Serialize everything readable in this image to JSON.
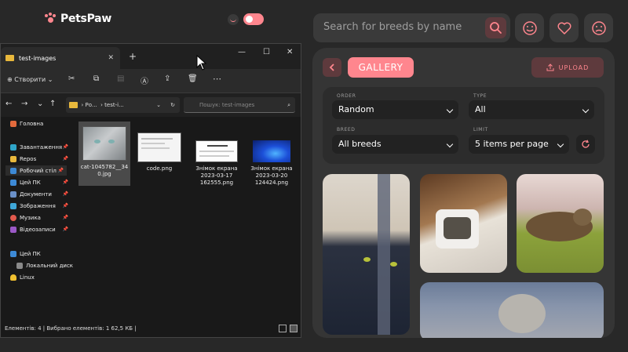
{
  "app": {
    "logo_text": "PetsPaw"
  },
  "search": {
    "placeholder": "Search for breeds by name"
  },
  "gallery": {
    "title": "GALLERY",
    "upload_label": "UPLOAD",
    "filters": {
      "order_label": "ORDER",
      "order_value": "Random",
      "type_label": "TYPE",
      "type_value": "All",
      "breed_label": "BREED",
      "breed_value": "All breeds",
      "limit_label": "LIMIT",
      "limit_value": "5 items per page"
    }
  },
  "explorer": {
    "tab_title": "test-images",
    "toolbar": {
      "create_label": "Створити"
    },
    "address": {
      "path_segments": [
        "Ро...",
        "test-i..."
      ],
      "search_placeholder": "Пошук: test-images"
    },
    "sidebar": [
      {
        "label": "Головна"
      },
      {
        "label": "Завантаження"
      },
      {
        "label": "Repos"
      },
      {
        "label": "Робочий стіл"
      },
      {
        "label": "Цей ПК"
      },
      {
        "label": "Документи"
      },
      {
        "label": "Зображення"
      },
      {
        "label": "Музика"
      },
      {
        "label": "Відеозаписи"
      },
      {
        "label": "Цей ПК"
      },
      {
        "label": "Локальний диск"
      },
      {
        "label": "Linux"
      }
    ],
    "files": [
      {
        "name": "cat-1045782__340.jpg"
      },
      {
        "name": "code.png"
      },
      {
        "name": "Знімок екрана 2023-03-17 162555.png"
      },
      {
        "name": "Знімок екрана 2023-03-20 124424.png"
      }
    ],
    "status": "Елементів: 4  |  Вибрано елементів: 1  62,5 КБ  |"
  },
  "colors": {
    "accent": "#ff868e",
    "accent_dark": "#5e3a3d",
    "background": "#282828",
    "panel": "#353535"
  }
}
